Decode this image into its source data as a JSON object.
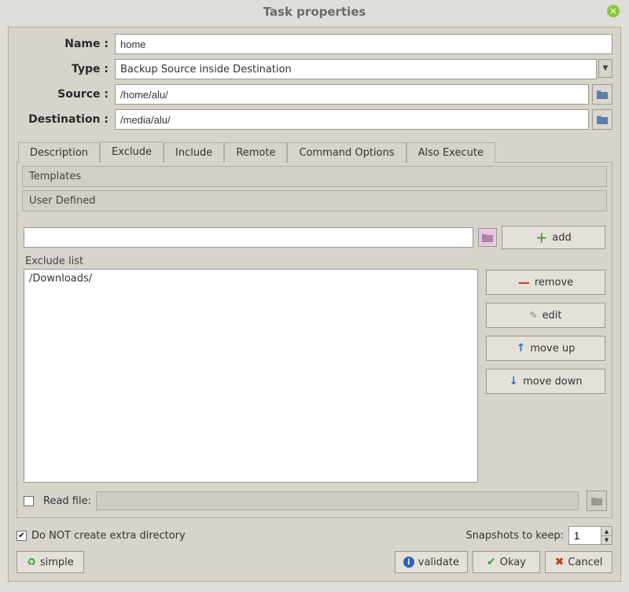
{
  "window_title": "Task properties",
  "fields": {
    "name_label": "Name :",
    "name_value": "home",
    "type_label": "Type :",
    "type_value": "Backup Source inside Destination",
    "source_label": "Source :",
    "source_value": "/home/alu/",
    "destination_label": "Destination :",
    "destination_value": "/media/alu/"
  },
  "tabs": {
    "description": "Description",
    "exclude": "Exclude",
    "include": "Include",
    "remote": "Remote",
    "command_options": "Command Options",
    "also_execute": "Also Execute",
    "active": "exclude"
  },
  "exclude_tab": {
    "templates_header": "Templates",
    "user_defined_header": "User Defined",
    "add_input_value": "",
    "add_button": "add",
    "list_label": "Exclude list",
    "list_items": [
      "/Downloads/"
    ],
    "remove_button": "remove",
    "edit_button": "edit",
    "moveup_button": "move up",
    "movedown_button": "move down",
    "readfile_label": "Read file:",
    "readfile_checked": false,
    "readfile_path": ""
  },
  "footer": {
    "no_extra_dir_label": "Do NOT create extra directory",
    "no_extra_dir_checked": true,
    "snapshots_label": "Snapshots to keep:",
    "snapshots_value": "1",
    "simple_button": "simple",
    "validate_button": "validate",
    "okay_button": "Okay",
    "cancel_button": "Cancel"
  }
}
